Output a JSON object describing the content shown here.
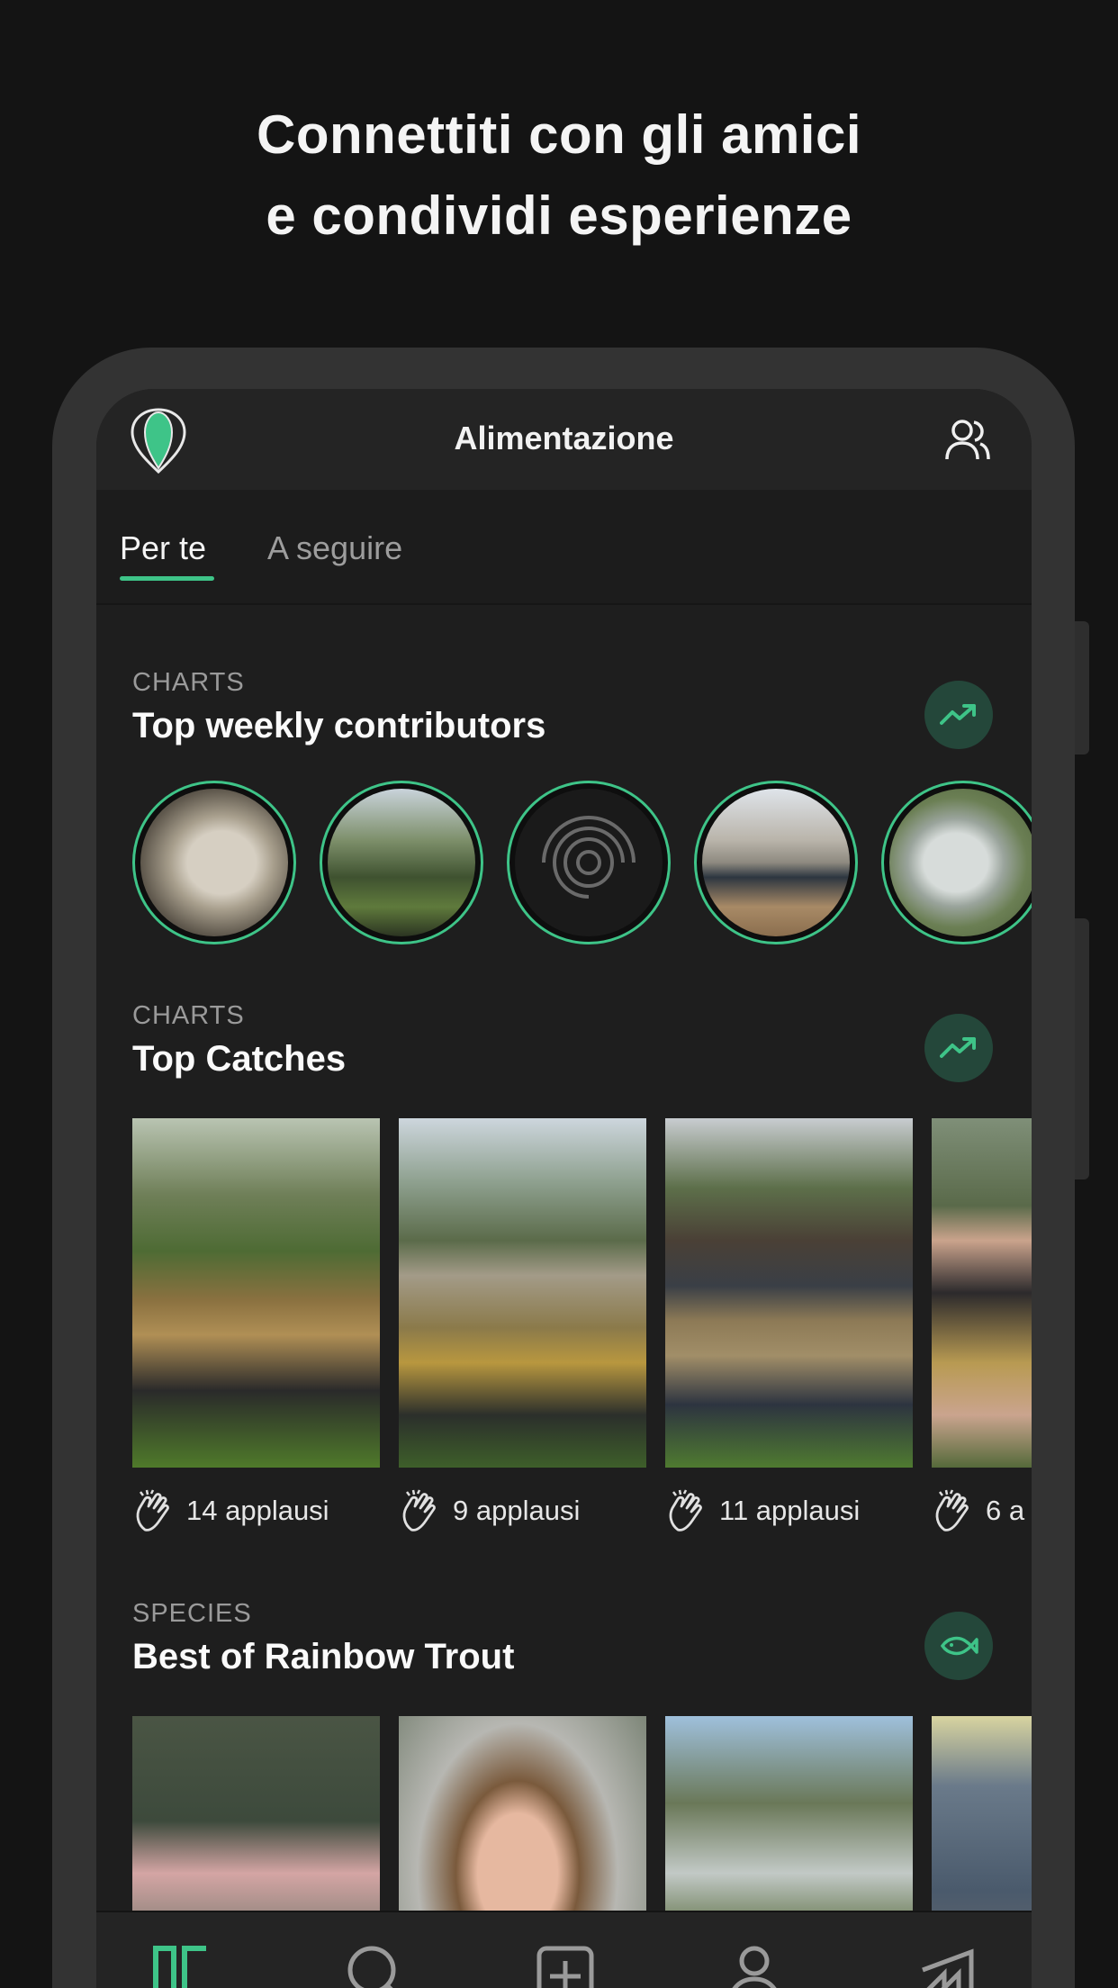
{
  "headline": {
    "line1": "Connettiti con gli amici",
    "line2": "e condividi esperienze"
  },
  "app": {
    "title": "Alimentazione",
    "logo_icon": "pin-logo-icon",
    "friends_icon": "people-icon"
  },
  "tabs": [
    {
      "label": "Per te",
      "active": true
    },
    {
      "label": "A seguire",
      "active": false
    }
  ],
  "colors": {
    "accent": "#3ec488",
    "background": "#1e1e1e",
    "page_background": "#141414",
    "badge_background": "#24473a"
  },
  "sections": {
    "contributors": {
      "label": "CHARTS",
      "title": "Top weekly contributors",
      "badge_icon": "trending-up-icon",
      "avatars": [
        "fish-photo",
        "angler-by-lake-photo",
        "default-avatar-icon",
        "angler-with-fish-photo",
        "trout-photo"
      ]
    },
    "catches": {
      "label": "CHARTS",
      "title": "Top Catches",
      "badge_icon": "trending-up-icon",
      "items": [
        {
          "applause": "14 applausi"
        },
        {
          "applause": "9 applausi"
        },
        {
          "applause": "11 applausi"
        },
        {
          "applause": "6 a"
        }
      ]
    },
    "species": {
      "label": "SPECIES",
      "title": "Best of Rainbow Trout",
      "badge_icon": "fish-icon"
    }
  },
  "nav": [
    "feed-icon",
    "search-icon",
    "add-catch-icon",
    "profile-icon",
    "map-icon"
  ]
}
